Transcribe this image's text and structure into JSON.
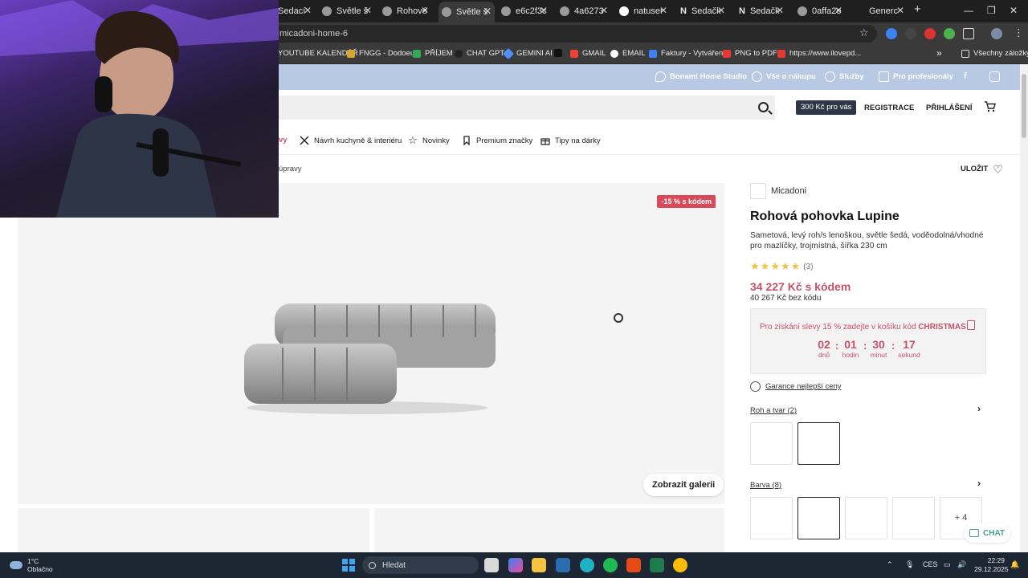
{
  "browser": {
    "tabs": [
      {
        "label": "Sedací"
      },
      {
        "label": "Světle š"
      },
      {
        "label": "Rohové"
      },
      {
        "label": "Světle š"
      },
      {
        "label": "e6c2f3c"
      },
      {
        "label": "4a6273"
      },
      {
        "label": "natuser"
      },
      {
        "label": "Sedačk"
      },
      {
        "label": "Sedačk"
      },
      {
        "label": "0affa2e"
      },
      {
        "label": "Generc"
      }
    ],
    "url": "micadoni-home-6",
    "bookmarks": [
      "YOUTUBE KALENDÁŘ",
      "FNGG - Dodoeu",
      "PŘÍJEM",
      "CHAT GPT",
      "GEMINI AI",
      "GMAIL",
      "EMAIL",
      "Faktury - Vytváření",
      "PNG to PDF",
      "https://www.ilovepd..."
    ],
    "all_bookmarks": "Všechny záložky"
  },
  "site": {
    "topstrip": [
      "Bonami Home Studio",
      "Vše o nákupu",
      "Služby",
      "Pro profesionály"
    ],
    "promo": "300 Kč pro vás",
    "register": "REGISTRACE",
    "login": "PŘIHLÁŠENÍ",
    "nav": {
      "partial": "vy",
      "items": [
        "Návrh kuchyně & interiéru",
        "Novinky",
        "Premium značky",
        "Tipy na dárky"
      ]
    },
    "breadcrumb": "úpravy",
    "save": "ULOŽIT",
    "gallery": {
      "discount_badge": "-15 % s kódem",
      "show_gallery": "Zobrazit galerii"
    },
    "product": {
      "brand": "Micadoni",
      "title": "Rohová pohovka Lupine",
      "description": "Sametová, levý roh/s lenoškou, světle šedá, voděodolná/vhodné pro mazlíčky, trojmístná, šířka 230 cm",
      "rating_count": "(3)",
      "price": "34 227 Kč s kódem",
      "old_price": "40 267 Kč bez kódu",
      "code_text": "Pro získání slevy 15 % zadejte v košíku kód",
      "code": "CHRISTMAS",
      "timer": {
        "days": "02",
        "days_label": "dnů",
        "hours": "01",
        "hours_label": "hodin",
        "minutes": "30",
        "minutes_label": "minut",
        "seconds": "17",
        "seconds_label": "sekund"
      },
      "guarantee": "Garance nejlepší ceny",
      "shape_label": "Roh a tvar (2)",
      "color_label": "Barva (8)",
      "more_colors": "+ 4"
    },
    "chat": "CHAT"
  },
  "taskbar": {
    "temp": "1°C",
    "weather": "Oblačno",
    "search": "Hledat",
    "lang": "CES",
    "time": "22:29",
    "date": "29.12.2025"
  },
  "colors": {
    "accent_price": "#c5526b",
    "topstrip": "#b8c9e3",
    "discount_badge": "#d84a5a"
  }
}
